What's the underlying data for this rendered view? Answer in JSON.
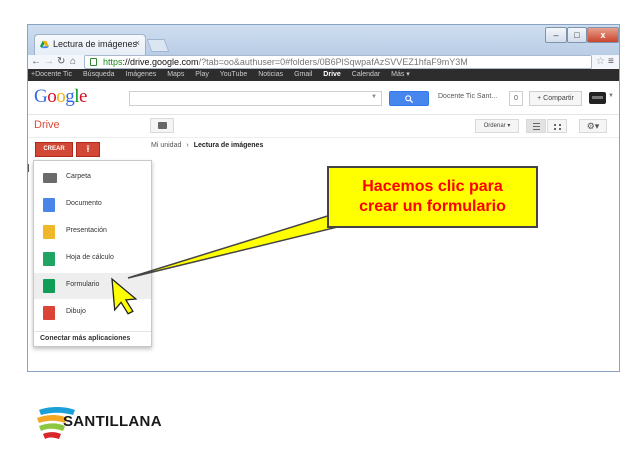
{
  "browser": {
    "tab_title": "Lectura de imágenes",
    "tab_close": "×",
    "url_scheme": "https",
    "url_domain": "://drive.google.com",
    "url_path": "/?tab=oo&authuser=0#folders/0B6PlSqwpafAzSVVEZ1hfaF9mY3M",
    "window_buttons": [
      "–",
      "□",
      "x"
    ]
  },
  "gbar": {
    "items": [
      "+Docente Tic",
      "Búsqueda",
      "Imágenes",
      "Maps",
      "Play",
      "YouTube",
      "Noticias",
      "Gmail",
      "Drive",
      "Calendar",
      "Más ▾"
    ],
    "active": "Drive"
  },
  "header": {
    "logo": "Google",
    "search_button_icon": "search-icon",
    "user": "Docente Tic Sant...",
    "notifications": "0",
    "share": "+ Compartir"
  },
  "drive": {
    "title": "Drive",
    "sort": "Ordenar ▾",
    "crear": "CREAR",
    "breadcrumb_root": "Mi unidad",
    "breadcrumb_sep": "›",
    "breadcrumb_current": "Lectura de imágenes"
  },
  "menu": {
    "items": [
      {
        "label": "Carpeta",
        "icon": "folder-icon",
        "color": "#6b6b6b"
      },
      {
        "label": "Documento",
        "icon": "document-icon",
        "color": "#4a86e8"
      },
      {
        "label": "Presentación",
        "icon": "presentation-icon",
        "color": "#f1b72a"
      },
      {
        "label": "Hoja de cálculo",
        "icon": "spreadsheet-icon",
        "color": "#1fa463"
      },
      {
        "label": "Formulario",
        "icon": "form-icon",
        "color": "#0f9d58"
      },
      {
        "label": "Dibujo",
        "icon": "drawing-icon",
        "color": "#db4437"
      }
    ],
    "highlighted": "Formulario",
    "more_apps": "Conectar más aplicaciones"
  },
  "callout": {
    "line1": "Hacemos clic para",
    "line2": "crear un formulario"
  },
  "brand": {
    "name": "SANTILLANA"
  },
  "colors": {
    "drive_red": "#dd4b39",
    "callout_bg": "#ffff00",
    "callout_text": "#ff0000",
    "cursor": "#ffff00"
  }
}
